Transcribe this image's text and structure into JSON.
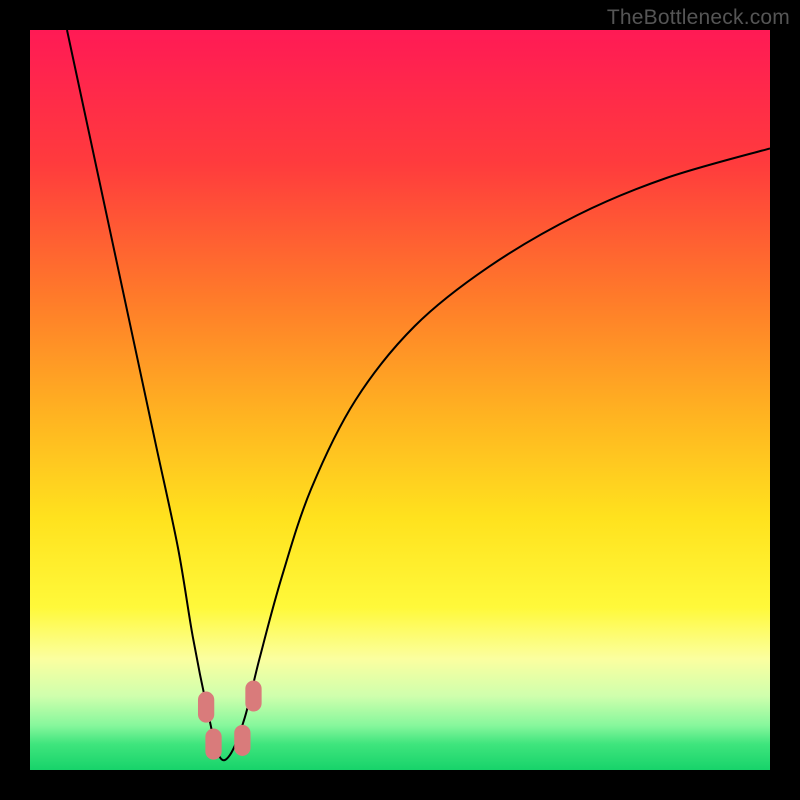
{
  "watermark": "TheBottleneck.com",
  "chart_data": {
    "type": "line",
    "title": "",
    "xlabel": "",
    "ylabel": "",
    "xlim": [
      0,
      100
    ],
    "ylim": [
      0,
      100
    ],
    "series": [
      {
        "name": "bottleneck-curve",
        "x": [
          5,
          8,
          11,
          14,
          17,
          20,
          22,
          24,
          25.5,
          27,
          29,
          31,
          34,
          38,
          44,
          52,
          62,
          74,
          86,
          100
        ],
        "y": [
          100,
          86,
          72,
          58,
          44,
          30,
          18,
          8,
          2,
          2,
          7,
          15,
          26,
          38,
          50,
          60,
          68,
          75,
          80,
          84
        ]
      }
    ],
    "markers": [
      {
        "name": "marker-left-upper",
        "x": 23.8,
        "y": 8.5
      },
      {
        "name": "marker-left-lower",
        "x": 24.8,
        "y": 3.5
      },
      {
        "name": "marker-right-lower",
        "x": 28.7,
        "y": 4.0
      },
      {
        "name": "marker-right-upper",
        "x": 30.2,
        "y": 10.0
      }
    ],
    "marker_color": "#d97b7b",
    "gradient_stops": [
      {
        "pos": 0.0,
        "color": "#ff1a55"
      },
      {
        "pos": 0.18,
        "color": "#ff3b3d"
      },
      {
        "pos": 0.36,
        "color": "#ff7a2a"
      },
      {
        "pos": 0.52,
        "color": "#ffb321"
      },
      {
        "pos": 0.66,
        "color": "#ffe21e"
      },
      {
        "pos": 0.78,
        "color": "#fff93a"
      },
      {
        "pos": 0.85,
        "color": "#fbffa0"
      },
      {
        "pos": 0.9,
        "color": "#cfffad"
      },
      {
        "pos": 0.94,
        "color": "#86f79c"
      },
      {
        "pos": 0.965,
        "color": "#3fe57d"
      },
      {
        "pos": 1.0,
        "color": "#17d36a"
      }
    ]
  }
}
